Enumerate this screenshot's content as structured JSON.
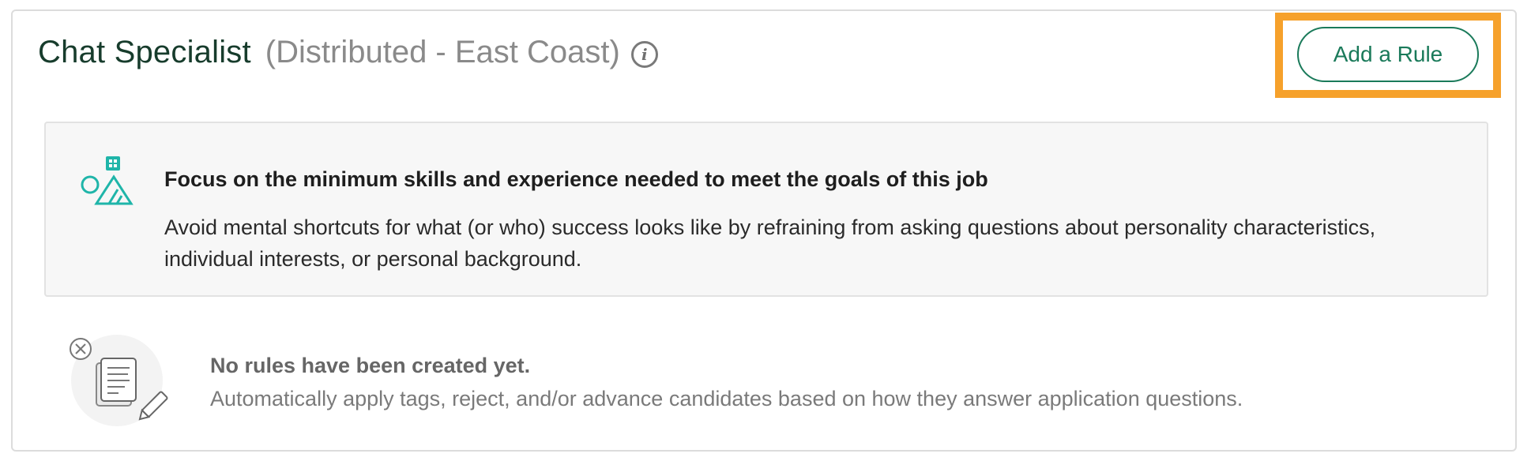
{
  "header": {
    "job_title": "Chat Specialist",
    "job_location": "(Distributed - East Coast)",
    "info_icon": "info-icon"
  },
  "actions": {
    "add_rule_label": "Add a Rule"
  },
  "tip": {
    "heading": "Focus on the minimum skills and experience needed to meet the goals of this job",
    "body": "Avoid mental shortcuts for what (or who) success looks like by refraining from asking questions about personality characteristics, individual interests, or personal background.",
    "icon": "shapes-icon"
  },
  "empty_state": {
    "heading": "No rules have been created yet.",
    "body": "Automatically apply tags, reject, and/or advance candidates based on how they answer application questions.",
    "icon": "document-edit-icon"
  },
  "colors": {
    "brand_green": "#1a7a5a",
    "title_green": "#173c2c",
    "highlight_orange": "#f6a12b",
    "tip_teal": "#1fb5a9"
  }
}
